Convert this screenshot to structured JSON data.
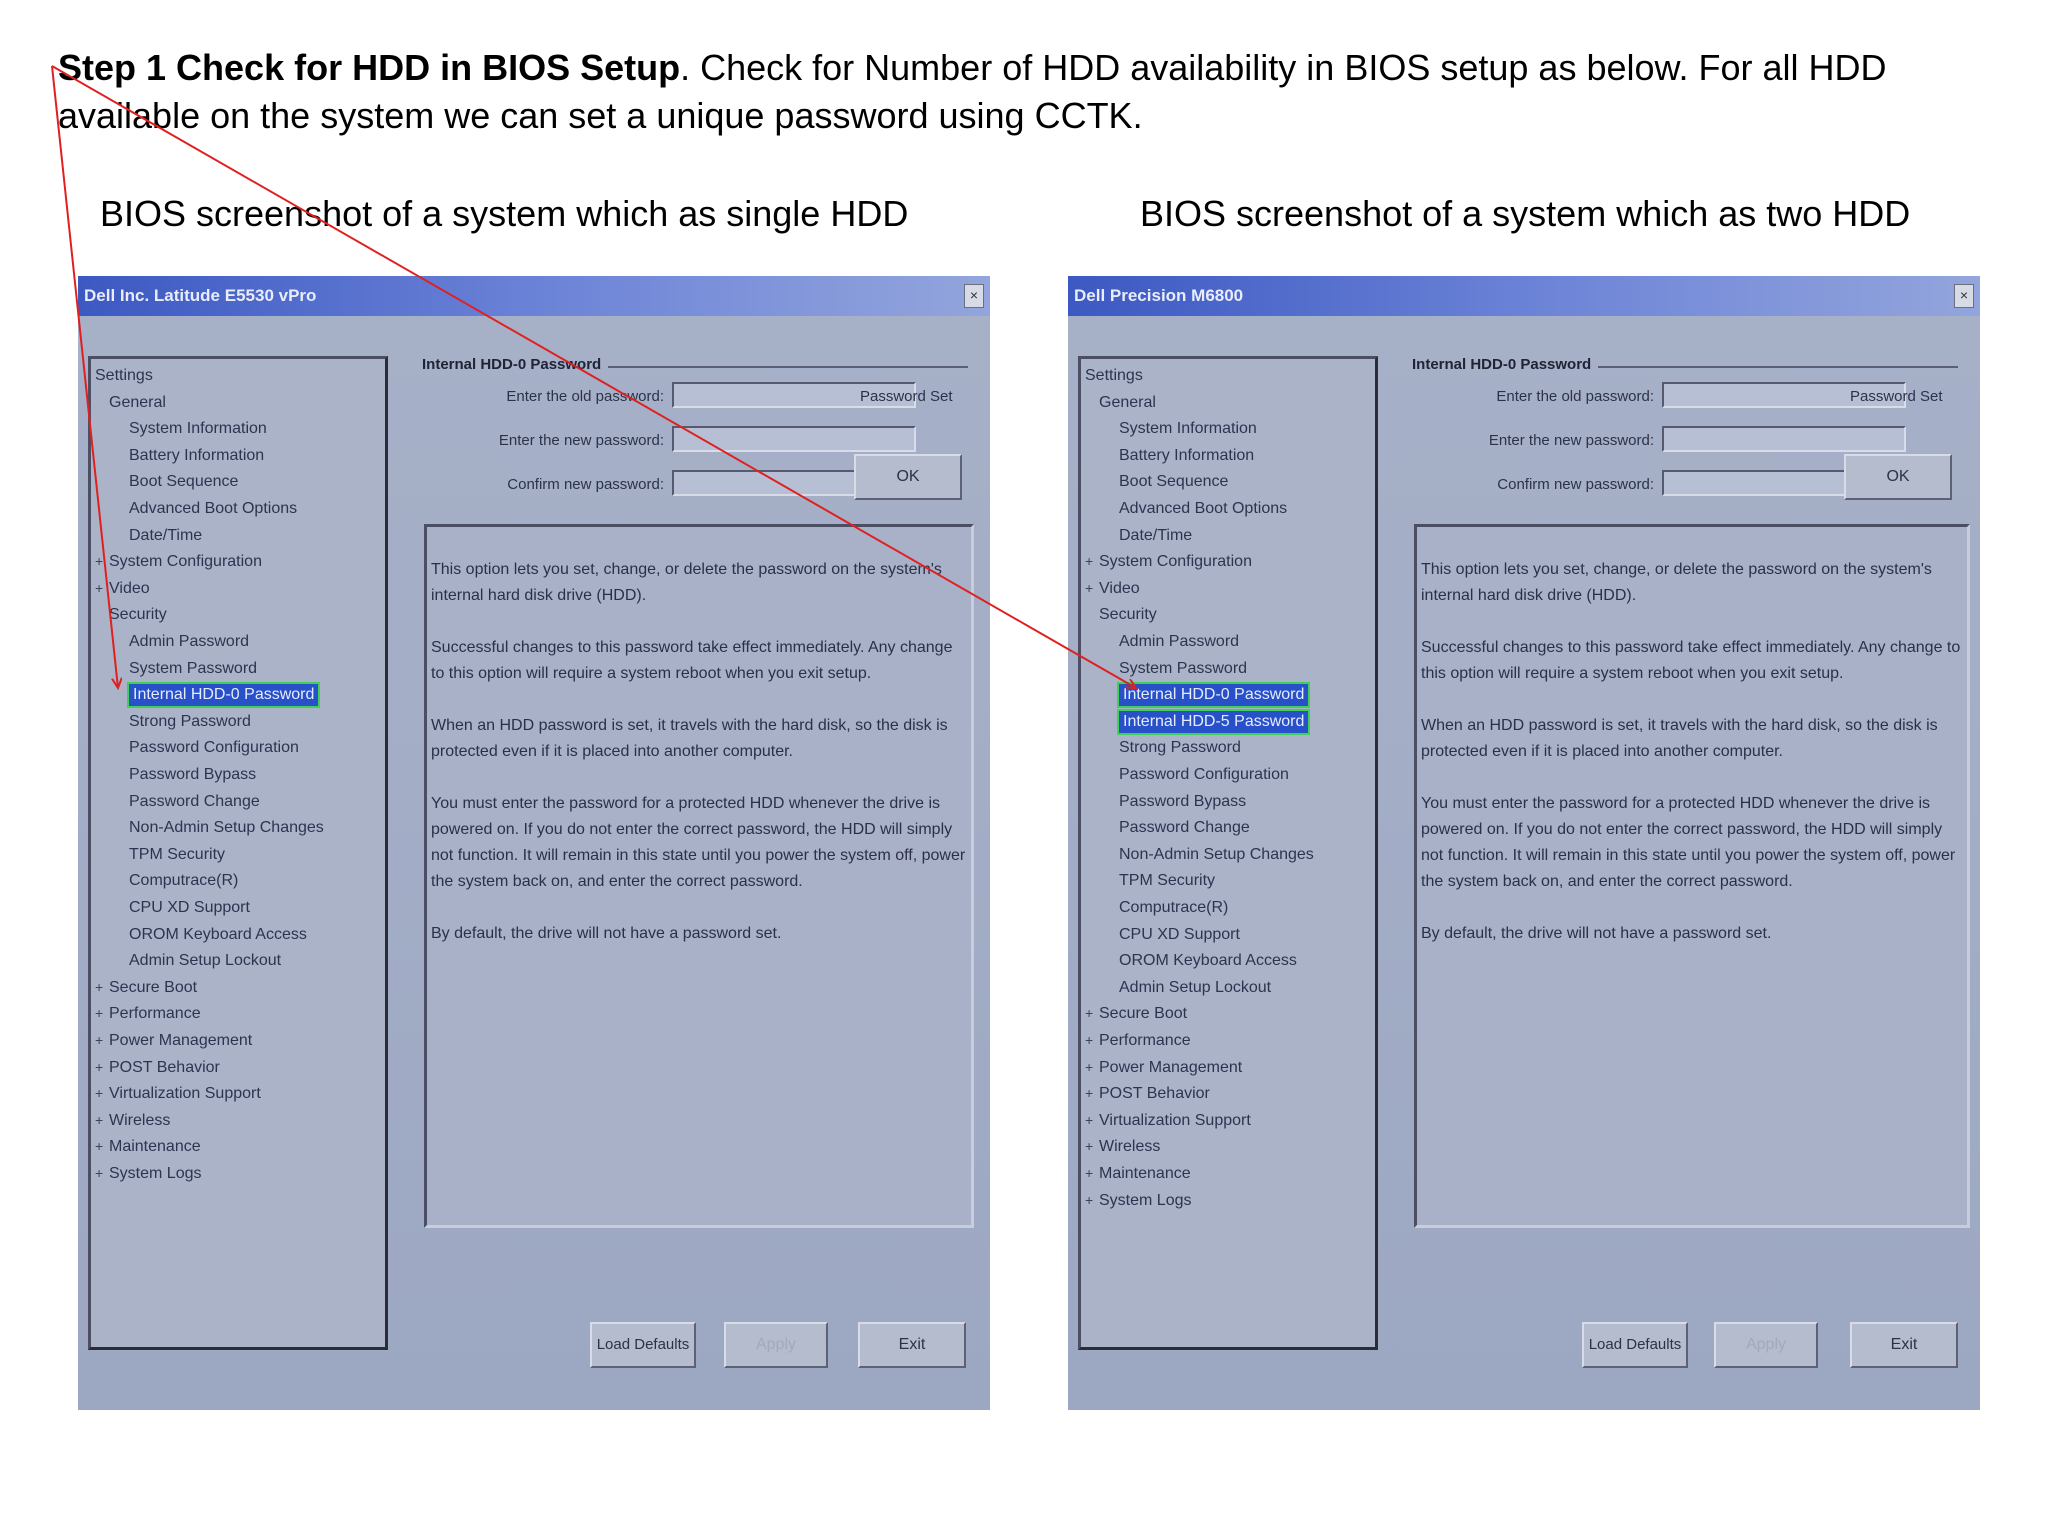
{
  "intro": {
    "bold": "Step 1 Check for HDD in BIOS Setup",
    "text": ". Check for Number of HDD availability in BIOS setup as below. For all HDD available on the system we can set a unique password using CCTK."
  },
  "captions": {
    "left": "BIOS screenshot of a system which as single HDD",
    "right": "BIOS screenshot of a system which as two HDD"
  },
  "screens": {
    "left": {
      "title": "Dell Inc. Latitude E5530 vPro",
      "close": "×",
      "tree": [
        "Settings",
        "General",
        "System Information",
        "Battery Information",
        "Boot Sequence",
        "Advanced Boot Options",
        "Date/Time",
        "System Configuration",
        "Video",
        "Security",
        "Admin Password",
        "System Password",
        "Internal HDD-0 Password",
        "Strong Password",
        "Password Configuration",
        "Password Bypass",
        "Password Change",
        "Non-Admin Setup Changes",
        "TPM Security",
        "Computrace(R)",
        "CPU XD Support",
        "OROM Keyboard Access",
        "Admin Setup Lockout",
        "Secure Boot",
        "Performance",
        "Power Management",
        "POST Behavior",
        "Virtualization Support",
        "Wireless",
        "Maintenance",
        "System Logs"
      ],
      "group": "Internal HDD-0 Password",
      "old_label": "Enter the old password:",
      "new_label": "Enter the new password:",
      "confirm_label": "Confirm new password:",
      "password_set": "Password Set",
      "ok": "OK",
      "desc": [
        "This option lets you set, change, or delete the password on the system's internal hard disk drive (HDD).",
        "Successful changes to this password take effect immediately. Any change to this option will require a system reboot when you exit setup.",
        "When an HDD password is set, it travels with the hard disk, so the disk is protected even if it is placed into another computer.",
        "You must enter the password for a protected HDD whenever the drive is powered on. If you do not enter the correct password, the HDD will simply not function. It will remain in this state until you power the system off, power the system back on, and enter the correct password.",
        "By default, the drive will not have a password set."
      ],
      "load_defaults": "Load Defaults",
      "apply": "Apply",
      "exit": "Exit"
    },
    "right": {
      "title": "Dell Precision M6800",
      "close": "×",
      "tree": [
        "Settings",
        "General",
        "System Information",
        "Battery Information",
        "Boot Sequence",
        "Advanced Boot Options",
        "Date/Time",
        "System Configuration",
        "Video",
        "Security",
        "Admin Password",
        "System Password",
        "Internal HDD-0 Password",
        "Internal HDD-5 Password",
        "Strong Password",
        "Password Configuration",
        "Password Bypass",
        "Password Change",
        "Non-Admin Setup Changes",
        "TPM Security",
        "Computrace(R)",
        "CPU XD Support",
        "OROM Keyboard Access",
        "Admin Setup Lockout",
        "Secure Boot",
        "Performance",
        "Power Management",
        "POST Behavior",
        "Virtualization Support",
        "Wireless",
        "Maintenance",
        "System Logs"
      ],
      "group": "Internal HDD-0 Password",
      "old_label": "Enter the old password:",
      "new_label": "Enter the new password:",
      "confirm_label": "Confirm new password:",
      "password_set": "Password Set",
      "ok": "OK",
      "desc": [
        "This option lets you set, change, or delete the password on the system's internal hard disk drive (HDD).",
        "Successful changes to this password take effect immediately. Any change to this option will require a system reboot when you exit setup.",
        "When an HDD password is set, it travels with the hard disk, so the disk is protected even if it is placed into another computer.",
        "You must enter the password for a protected HDD whenever the drive is powered on. If you do not enter the correct password, the HDD will simply not function. It will remain in this state until you power the system off, power the system back on, and enter the correct password.",
        "By default, the drive will not have a password set."
      ],
      "load_defaults": "Load Defaults",
      "apply": "Apply",
      "exit": "Exit"
    }
  },
  "colors": {
    "arrow": "#e02020",
    "selection": "#2850c8",
    "highlight_box": "#3fd05a"
  }
}
